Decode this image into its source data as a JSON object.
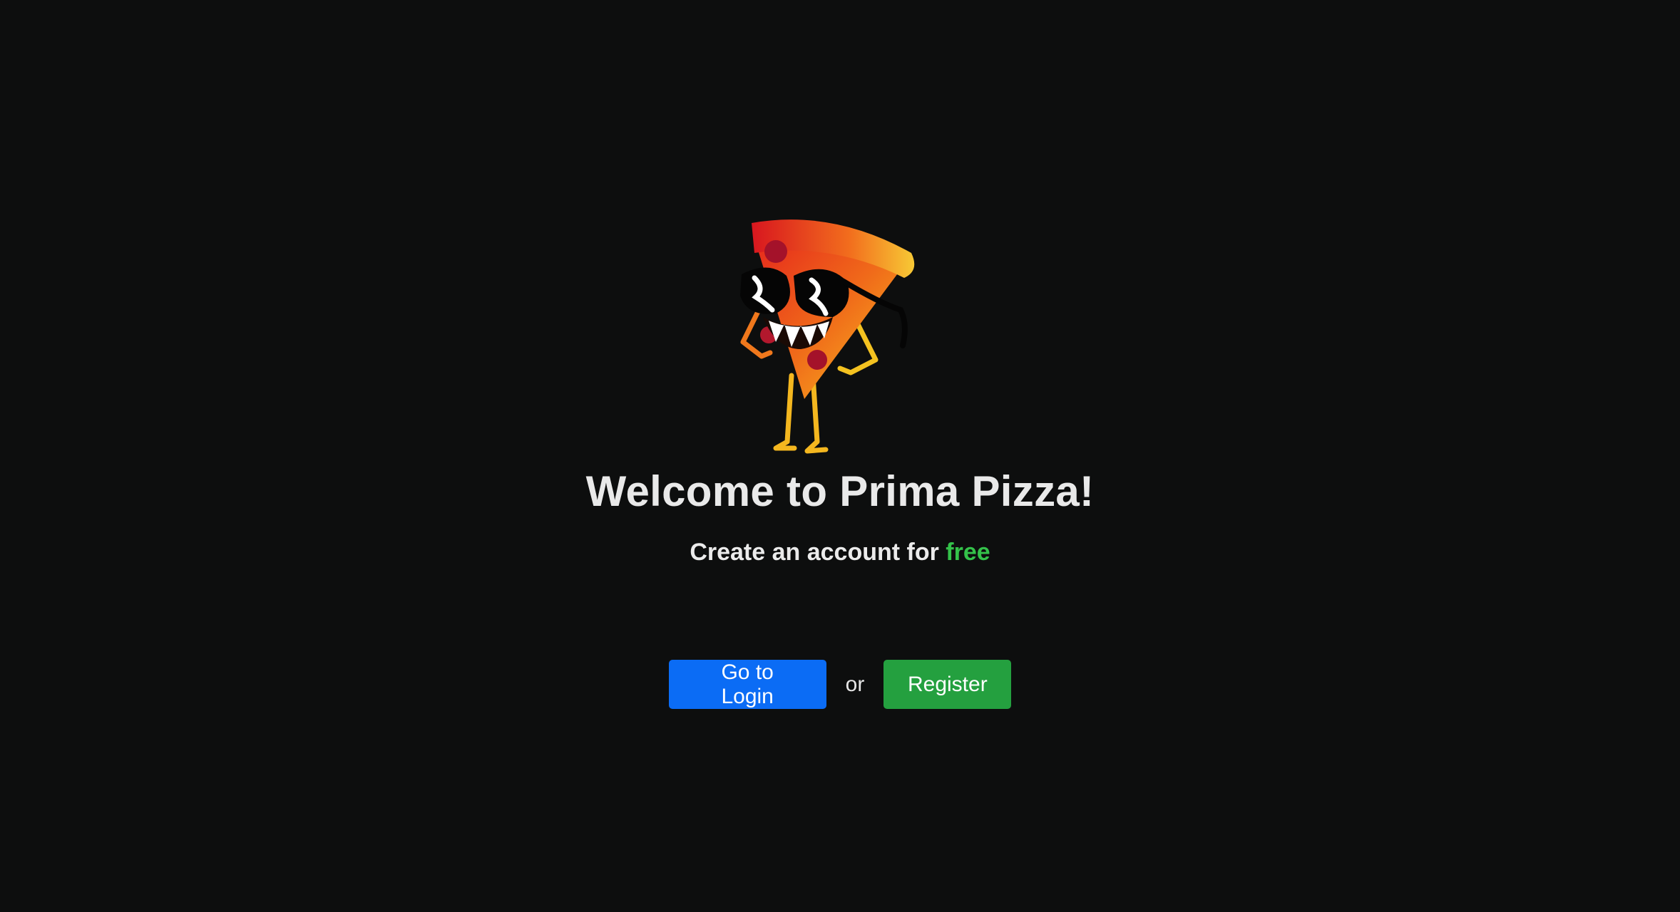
{
  "welcome": {
    "title": "Welcome to Prima Pizza!",
    "subtitle_prefix": "Create an account for ",
    "subtitle_accent": "free"
  },
  "actions": {
    "login_label": "Go to Login",
    "separator": "or",
    "register_label": "Register"
  },
  "mascot": {
    "icon": "pizza-slice-mascot-icon"
  },
  "colors": {
    "background": "#0d0e0e",
    "accent_green": "#34c24a",
    "login_button": "#0b6cf5",
    "register_button": "#24a03f"
  }
}
